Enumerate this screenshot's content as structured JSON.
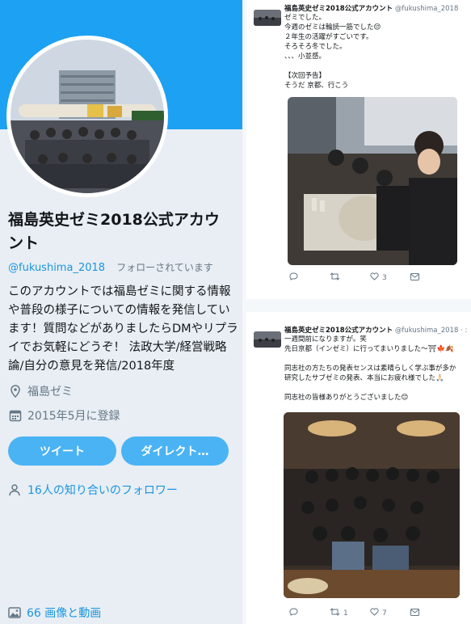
{
  "profile": {
    "name": "福島英史ゼミ2018公式アカウント",
    "handle": "@fukushima_2018",
    "follows_you": "フォローされています",
    "bio": "このアカウントでは福島ゼミに関する情報や普段の様子についての情報を発信しています！質問などがありましたらDMやリプライでお気軽にどうぞ！ 法政大学/経営戦略論/自分の意見を発信/2018年度",
    "location": "福島ゼミ",
    "joined": "2015年5月に登録",
    "tweet_button": "ツイート",
    "dm_button": "ダイレクト…",
    "mutual_followers": "16人の知り合いのフォロワー",
    "media_count": "66 画像と動画"
  },
  "tweets": [
    {
      "author": "福島英史ゼミ2018公式アカウント",
      "handle": "@fukushima_2018",
      "text": "ゼミでした。\n今週のゼミは輪読一筋でした😌\n２年生の活躍がすごいです。\nそろそろ冬でした。\n、、、小並感。\n\n【次回予告】\nそうだ 京都、行こう",
      "reply_count": "",
      "retweet_count": "",
      "like_count": "3",
      "dm_label": ""
    },
    {
      "author": "福島英史ゼミ2018公式アカウント",
      "handle": "@fukushima_2018 · :",
      "text": "一週間前になりますが。笑\n先日京都（インゼミ）に行ってまいりました〜⛩🍁🍂\n\n同志社の方たちの発表センスは素晴らしく学ぶ事が多か\n研究したサブゼミの発表、本当にお疲れ様でした🙏🏻\n\n同志社の皆様ありがとうございました😊",
      "reply_count": "",
      "retweet_count": "1",
      "like_count": "7",
      "dm_label": ""
    }
  ],
  "colors": {
    "accent": "#1da1f2",
    "button": "#4ab3f4",
    "link": "#1b95e0",
    "muted": "#657786",
    "panel": "#e8eef4"
  },
  "icons": [
    "location-icon",
    "calendar-icon",
    "people-icon",
    "image-icon",
    "reply-icon",
    "retweet-icon",
    "like-icon",
    "dm-icon"
  ]
}
